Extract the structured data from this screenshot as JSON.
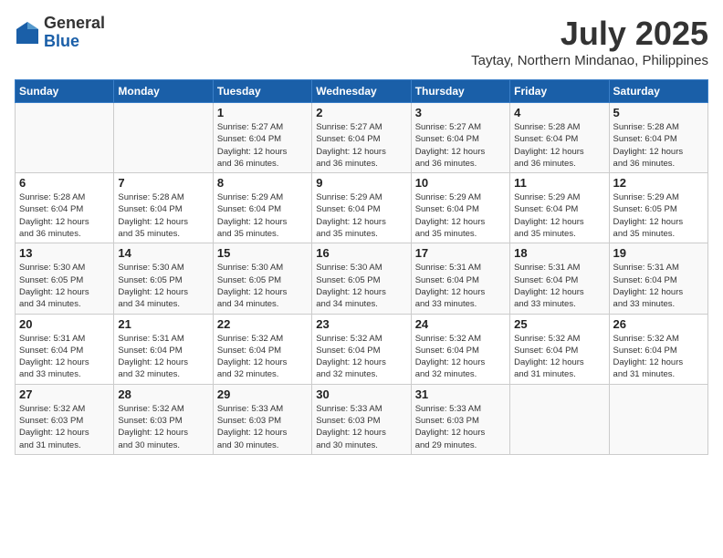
{
  "header": {
    "logo_general": "General",
    "logo_blue": "Blue",
    "month_title": "July 2025",
    "location": "Taytay, Northern Mindanao, Philippines"
  },
  "calendar": {
    "days_of_week": [
      "Sunday",
      "Monday",
      "Tuesday",
      "Wednesday",
      "Thursday",
      "Friday",
      "Saturday"
    ],
    "weeks": [
      [
        {
          "day": "",
          "info": ""
        },
        {
          "day": "",
          "info": ""
        },
        {
          "day": "1",
          "info": "Sunrise: 5:27 AM\nSunset: 6:04 PM\nDaylight: 12 hours\nand 36 minutes."
        },
        {
          "day": "2",
          "info": "Sunrise: 5:27 AM\nSunset: 6:04 PM\nDaylight: 12 hours\nand 36 minutes."
        },
        {
          "day": "3",
          "info": "Sunrise: 5:27 AM\nSunset: 6:04 PM\nDaylight: 12 hours\nand 36 minutes."
        },
        {
          "day": "4",
          "info": "Sunrise: 5:28 AM\nSunset: 6:04 PM\nDaylight: 12 hours\nand 36 minutes."
        },
        {
          "day": "5",
          "info": "Sunrise: 5:28 AM\nSunset: 6:04 PM\nDaylight: 12 hours\nand 36 minutes."
        }
      ],
      [
        {
          "day": "6",
          "info": "Sunrise: 5:28 AM\nSunset: 6:04 PM\nDaylight: 12 hours\nand 36 minutes."
        },
        {
          "day": "7",
          "info": "Sunrise: 5:28 AM\nSunset: 6:04 PM\nDaylight: 12 hours\nand 35 minutes."
        },
        {
          "day": "8",
          "info": "Sunrise: 5:29 AM\nSunset: 6:04 PM\nDaylight: 12 hours\nand 35 minutes."
        },
        {
          "day": "9",
          "info": "Sunrise: 5:29 AM\nSunset: 6:04 PM\nDaylight: 12 hours\nand 35 minutes."
        },
        {
          "day": "10",
          "info": "Sunrise: 5:29 AM\nSunset: 6:04 PM\nDaylight: 12 hours\nand 35 minutes."
        },
        {
          "day": "11",
          "info": "Sunrise: 5:29 AM\nSunset: 6:04 PM\nDaylight: 12 hours\nand 35 minutes."
        },
        {
          "day": "12",
          "info": "Sunrise: 5:29 AM\nSunset: 6:05 PM\nDaylight: 12 hours\nand 35 minutes."
        }
      ],
      [
        {
          "day": "13",
          "info": "Sunrise: 5:30 AM\nSunset: 6:05 PM\nDaylight: 12 hours\nand 34 minutes."
        },
        {
          "day": "14",
          "info": "Sunrise: 5:30 AM\nSunset: 6:05 PM\nDaylight: 12 hours\nand 34 minutes."
        },
        {
          "day": "15",
          "info": "Sunrise: 5:30 AM\nSunset: 6:05 PM\nDaylight: 12 hours\nand 34 minutes."
        },
        {
          "day": "16",
          "info": "Sunrise: 5:30 AM\nSunset: 6:05 PM\nDaylight: 12 hours\nand 34 minutes."
        },
        {
          "day": "17",
          "info": "Sunrise: 5:31 AM\nSunset: 6:04 PM\nDaylight: 12 hours\nand 33 minutes."
        },
        {
          "day": "18",
          "info": "Sunrise: 5:31 AM\nSunset: 6:04 PM\nDaylight: 12 hours\nand 33 minutes."
        },
        {
          "day": "19",
          "info": "Sunrise: 5:31 AM\nSunset: 6:04 PM\nDaylight: 12 hours\nand 33 minutes."
        }
      ],
      [
        {
          "day": "20",
          "info": "Sunrise: 5:31 AM\nSunset: 6:04 PM\nDaylight: 12 hours\nand 33 minutes."
        },
        {
          "day": "21",
          "info": "Sunrise: 5:31 AM\nSunset: 6:04 PM\nDaylight: 12 hours\nand 32 minutes."
        },
        {
          "day": "22",
          "info": "Sunrise: 5:32 AM\nSunset: 6:04 PM\nDaylight: 12 hours\nand 32 minutes."
        },
        {
          "day": "23",
          "info": "Sunrise: 5:32 AM\nSunset: 6:04 PM\nDaylight: 12 hours\nand 32 minutes."
        },
        {
          "day": "24",
          "info": "Sunrise: 5:32 AM\nSunset: 6:04 PM\nDaylight: 12 hours\nand 32 minutes."
        },
        {
          "day": "25",
          "info": "Sunrise: 5:32 AM\nSunset: 6:04 PM\nDaylight: 12 hours\nand 31 minutes."
        },
        {
          "day": "26",
          "info": "Sunrise: 5:32 AM\nSunset: 6:04 PM\nDaylight: 12 hours\nand 31 minutes."
        }
      ],
      [
        {
          "day": "27",
          "info": "Sunrise: 5:32 AM\nSunset: 6:03 PM\nDaylight: 12 hours\nand 31 minutes."
        },
        {
          "day": "28",
          "info": "Sunrise: 5:32 AM\nSunset: 6:03 PM\nDaylight: 12 hours\nand 30 minutes."
        },
        {
          "day": "29",
          "info": "Sunrise: 5:33 AM\nSunset: 6:03 PM\nDaylight: 12 hours\nand 30 minutes."
        },
        {
          "day": "30",
          "info": "Sunrise: 5:33 AM\nSunset: 6:03 PM\nDaylight: 12 hours\nand 30 minutes."
        },
        {
          "day": "31",
          "info": "Sunrise: 5:33 AM\nSunset: 6:03 PM\nDaylight: 12 hours\nand 29 minutes."
        },
        {
          "day": "",
          "info": ""
        },
        {
          "day": "",
          "info": ""
        }
      ]
    ]
  }
}
